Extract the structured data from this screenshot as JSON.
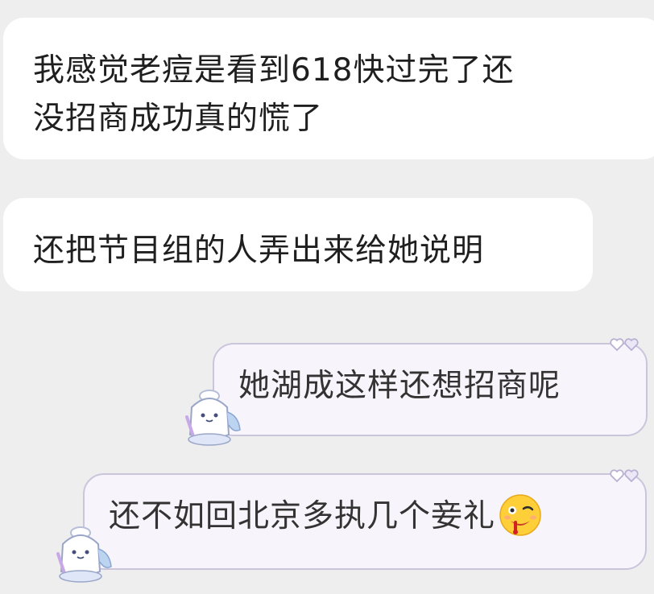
{
  "messages": [
    {
      "side": "left",
      "text_lines": [
        "我感觉老痘是看到618快过完了还",
        "没招商成功真的慌了"
      ]
    },
    {
      "side": "left",
      "text": "还把节目组的人弄出来给她说明"
    },
    {
      "side": "right",
      "text": "她湖成这样还想招商呢",
      "sticker": "mascot-sticker",
      "decoration": "double-heart-icon"
    },
    {
      "side": "right",
      "text": "还不如回北京多执几个妾礼",
      "emoji": "drooling-bleeding-face-emoji",
      "sticker": "mascot-sticker",
      "decoration": "double-heart-icon"
    }
  ],
  "colors": {
    "background": "#eeeeee",
    "incoming_bubble": "#ffffff",
    "outgoing_bubble": "#f7f5fb",
    "outgoing_border": "#cbc5dc",
    "text": "#1f1f1f"
  }
}
